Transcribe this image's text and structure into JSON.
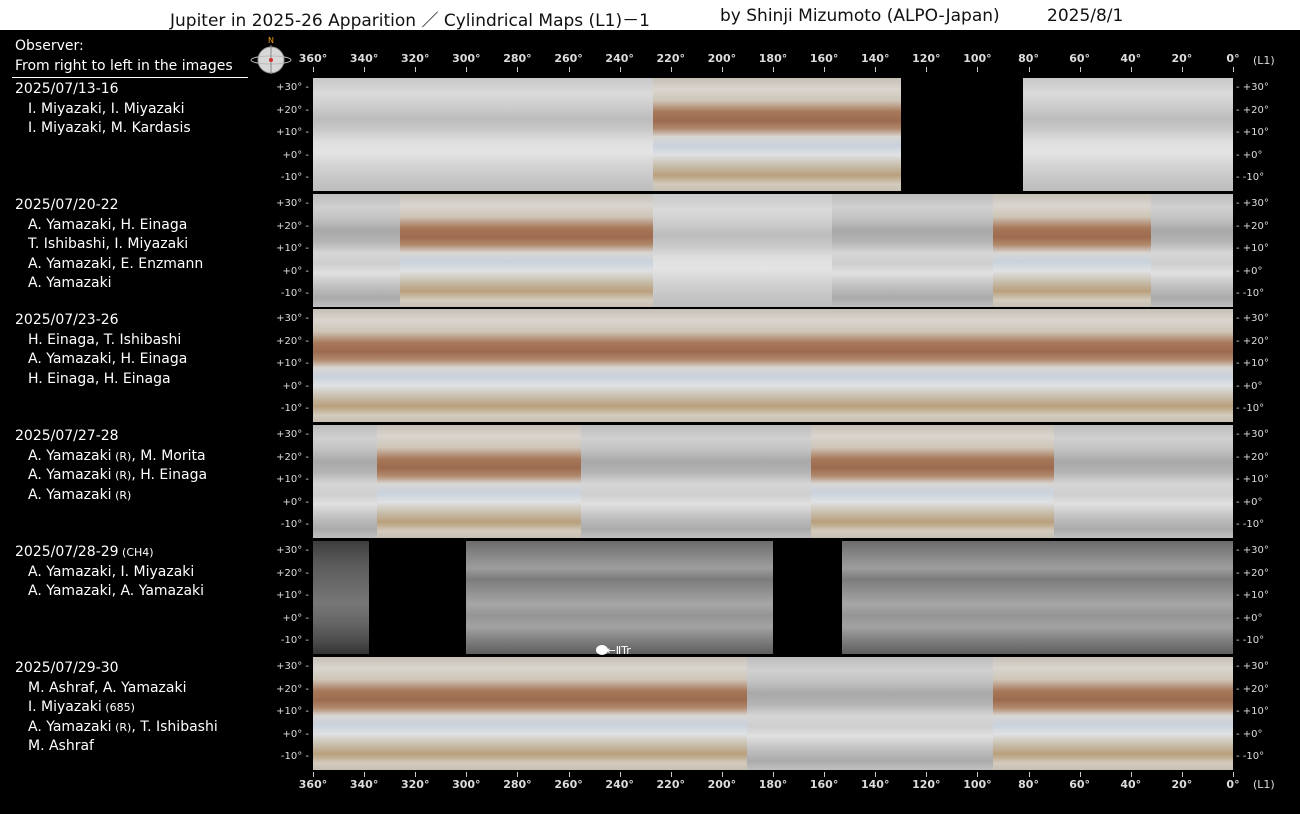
{
  "title": {
    "main": "Jupiter in 2025-26 Apparition ／ Cylindrical Maps (L1)－1",
    "author": "by Shinji Mizumoto (ALPO-Japan)",
    "date": "2025/8/1"
  },
  "observer_header": {
    "line1": "Observer:",
    "line2": "From right to left in the images"
  },
  "compass": {
    "north_label": "N",
    "icon": "globe-compass-icon"
  },
  "lon_axis": {
    "ticks": [
      "360°",
      "340°",
      "320°",
      "300°",
      "280°",
      "260°",
      "240°",
      "220°",
      "200°",
      "180°",
      "160°",
      "140°",
      "120°",
      "100°",
      "80°",
      "60°",
      "40°",
      "20°",
      "0°"
    ],
    "label": "(L1)"
  },
  "lat_ticks": [
    "+30°",
    "+20°",
    "+10°",
    "+0°",
    "-10°"
  ],
  "panels": [
    {
      "date": "2025/07/13-16",
      "date_suffix": "",
      "observers": [
        {
          "name": "I. Miyazaki, I. Miyazaki"
        },
        {
          "name": "I. Miyazaki, M. Kardasis"
        }
      ],
      "segments": [
        {
          "from": 360,
          "to": 300,
          "style": "pale"
        },
        {
          "from": 300,
          "to": 227,
          "style": "pale"
        },
        {
          "from": 227,
          "to": 130,
          "style": "color"
        },
        {
          "from": 130,
          "to": 82,
          "style": "black"
        },
        {
          "from": 82,
          "to": 0,
          "style": "pale"
        }
      ]
    },
    {
      "date": "2025/07/20-22",
      "date_suffix": "",
      "observers": [
        {
          "name": "A. Yamazaki, H. Einaga"
        },
        {
          "name": "T. Ishibashi, I. Miyazaki"
        },
        {
          "name": "A. Yamazaki, E. Enzmann"
        },
        {
          "name": "A. Yamazaki"
        }
      ],
      "segments": [
        {
          "from": 360,
          "to": 326,
          "style": "grey"
        },
        {
          "from": 326,
          "to": 227,
          "style": "color"
        },
        {
          "from": 227,
          "to": 157,
          "style": "pale"
        },
        {
          "from": 157,
          "to": 94,
          "style": "grey"
        },
        {
          "from": 94,
          "to": 32,
          "style": "color"
        },
        {
          "from": 32,
          "to": 0,
          "style": "grey"
        }
      ]
    },
    {
      "date": "2025/07/23-26",
      "date_suffix": "",
      "observers": [
        {
          "name": "H. Einaga, T. Ishibashi"
        },
        {
          "name": "A. Yamazaki, H. Einaga"
        },
        {
          "name": "H. Einaga, H. Einaga"
        }
      ],
      "segments": [
        {
          "from": 360,
          "to": 300,
          "style": "color"
        },
        {
          "from": 300,
          "to": 230,
          "style": "color"
        },
        {
          "from": 230,
          "to": 165,
          "style": "color"
        },
        {
          "from": 165,
          "to": 72,
          "style": "color"
        },
        {
          "from": 72,
          "to": 0,
          "style": "color"
        }
      ]
    },
    {
      "date": "2025/07/27-28",
      "date_suffix": "",
      "observers": [
        {
          "name": "A. Yamazaki",
          "tag": "(R)",
          "rest": ", M. Morita"
        },
        {
          "name": "A. Yamazaki",
          "tag": "(R)",
          "rest": ", H. Einaga"
        },
        {
          "name": "A. Yamazaki",
          "tag": "(R)",
          "rest": ""
        }
      ],
      "segments": [
        {
          "from": 360,
          "to": 335,
          "style": "grey"
        },
        {
          "from": 335,
          "to": 255,
          "style": "color"
        },
        {
          "from": 255,
          "to": 165,
          "style": "grey"
        },
        {
          "from": 165,
          "to": 70,
          "style": "color"
        },
        {
          "from": 70,
          "to": 0,
          "style": "grey"
        }
      ]
    },
    {
      "date": "2025/07/28-29",
      "date_suffix": "(CH4)",
      "observers": [
        {
          "name": "A. Yamazaki, I. Miyazaki"
        },
        {
          "name": "A. Yamazaki, A. Yamazaki"
        }
      ],
      "segments": [
        {
          "from": 360,
          "to": 338,
          "style": "ch4-dark"
        },
        {
          "from": 338,
          "to": 300,
          "style": "black"
        },
        {
          "from": 300,
          "to": 180,
          "style": "ch4"
        },
        {
          "from": 180,
          "to": 153,
          "style": "black"
        },
        {
          "from": 153,
          "to": 72,
          "style": "ch4"
        },
        {
          "from": 72,
          "to": 0,
          "style": "ch4"
        }
      ],
      "annotation": "←ⅡTr"
    },
    {
      "date": "2025/07/29-30",
      "date_suffix": "",
      "observers": [
        {
          "name": "M. Ashraf, A. Yamazaki"
        },
        {
          "name": "I. Miyazaki",
          "tag": "(685)",
          "rest": ""
        },
        {
          "name": "A. Yamazaki",
          "tag": "(R)",
          "rest": ", T. Ishibashi"
        },
        {
          "name": "M. Ashraf"
        }
      ],
      "segments": [
        {
          "from": 360,
          "to": 268,
          "style": "color"
        },
        {
          "from": 268,
          "to": 190,
          "style": "color"
        },
        {
          "from": 190,
          "to": 94,
          "style": "grey"
        },
        {
          "from": 94,
          "to": 18,
          "style": "color"
        },
        {
          "from": 18,
          "to": 0,
          "style": "color"
        }
      ]
    }
  ]
}
